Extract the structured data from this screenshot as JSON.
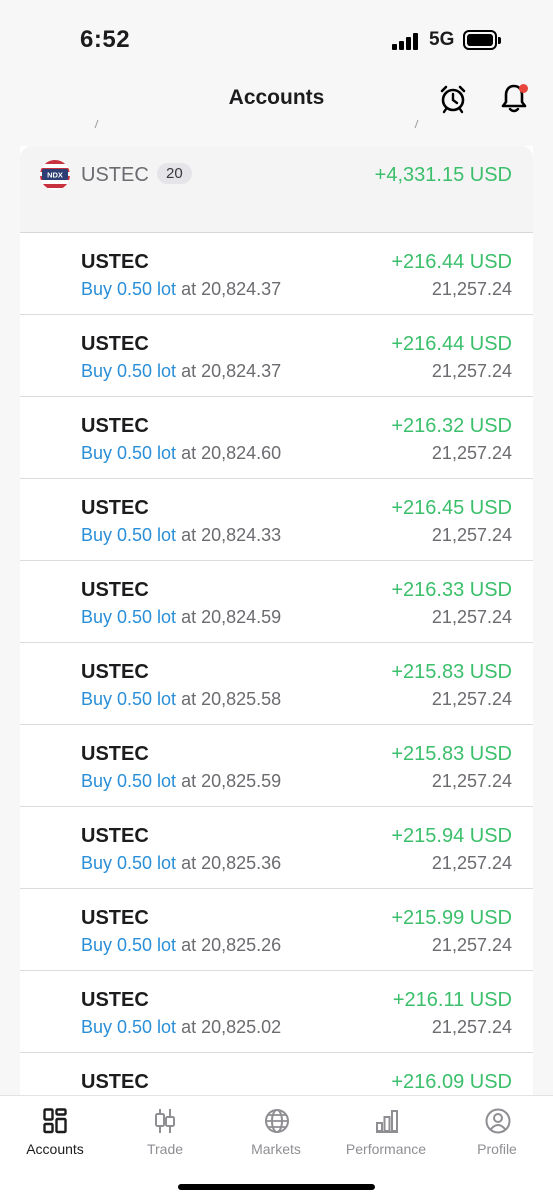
{
  "status_bar": {
    "time": "6:52",
    "network": "5G"
  },
  "header": {
    "title": "Accounts"
  },
  "group": {
    "symbol": "USTEC",
    "flag_label": "NDX",
    "count": "20",
    "profit": "+4,331.15 USD"
  },
  "positions": [
    {
      "symbol": "USTEC",
      "type": "Buy 0.50 lot",
      "at": "at 20,824.37",
      "profit": "+216.44 USD",
      "price": "21,257.24"
    },
    {
      "symbol": "USTEC",
      "type": "Buy 0.50 lot",
      "at": "at 20,824.37",
      "profit": "+216.44 USD",
      "price": "21,257.24"
    },
    {
      "symbol": "USTEC",
      "type": "Buy 0.50 lot",
      "at": "at 20,824.60",
      "profit": "+216.32 USD",
      "price": "21,257.24"
    },
    {
      "symbol": "USTEC",
      "type": "Buy 0.50 lot",
      "at": "at 20,824.33",
      "profit": "+216.45 USD",
      "price": "21,257.24"
    },
    {
      "symbol": "USTEC",
      "type": "Buy 0.50 lot",
      "at": "at 20,824.59",
      "profit": "+216.33 USD",
      "price": "21,257.24"
    },
    {
      "symbol": "USTEC",
      "type": "Buy 0.50 lot",
      "at": "at 20,825.58",
      "profit": "+215.83 USD",
      "price": "21,257.24"
    },
    {
      "symbol": "USTEC",
      "type": "Buy 0.50 lot",
      "at": "at 20,825.59",
      "profit": "+215.83 USD",
      "price": "21,257.24"
    },
    {
      "symbol": "USTEC",
      "type": "Buy 0.50 lot",
      "at": "at 20,825.36",
      "profit": "+215.94 USD",
      "price": "21,257.24"
    },
    {
      "symbol": "USTEC",
      "type": "Buy 0.50 lot",
      "at": "at 20,825.26",
      "profit": "+215.99 USD",
      "price": "21,257.24"
    },
    {
      "symbol": "USTEC",
      "type": "Buy 0.50 lot",
      "at": "at 20,825.02",
      "profit": "+216.11 USD",
      "price": "21,257.24"
    },
    {
      "symbol": "USTEC",
      "type": "",
      "at": "",
      "profit": "+216.09 USD",
      "price": ""
    }
  ],
  "tabs": [
    {
      "label": "Accounts",
      "icon": "accounts-icon",
      "active": true
    },
    {
      "label": "Trade",
      "icon": "trade-icon",
      "active": false
    },
    {
      "label": "Markets",
      "icon": "markets-icon",
      "active": false
    },
    {
      "label": "Performance",
      "icon": "performance-icon",
      "active": false
    },
    {
      "label": "Profile",
      "icon": "profile-icon",
      "active": false
    }
  ],
  "colors": {
    "profit": "#3bbf6b",
    "link": "#2a8fd8",
    "notification_dot": "#e8453c"
  }
}
